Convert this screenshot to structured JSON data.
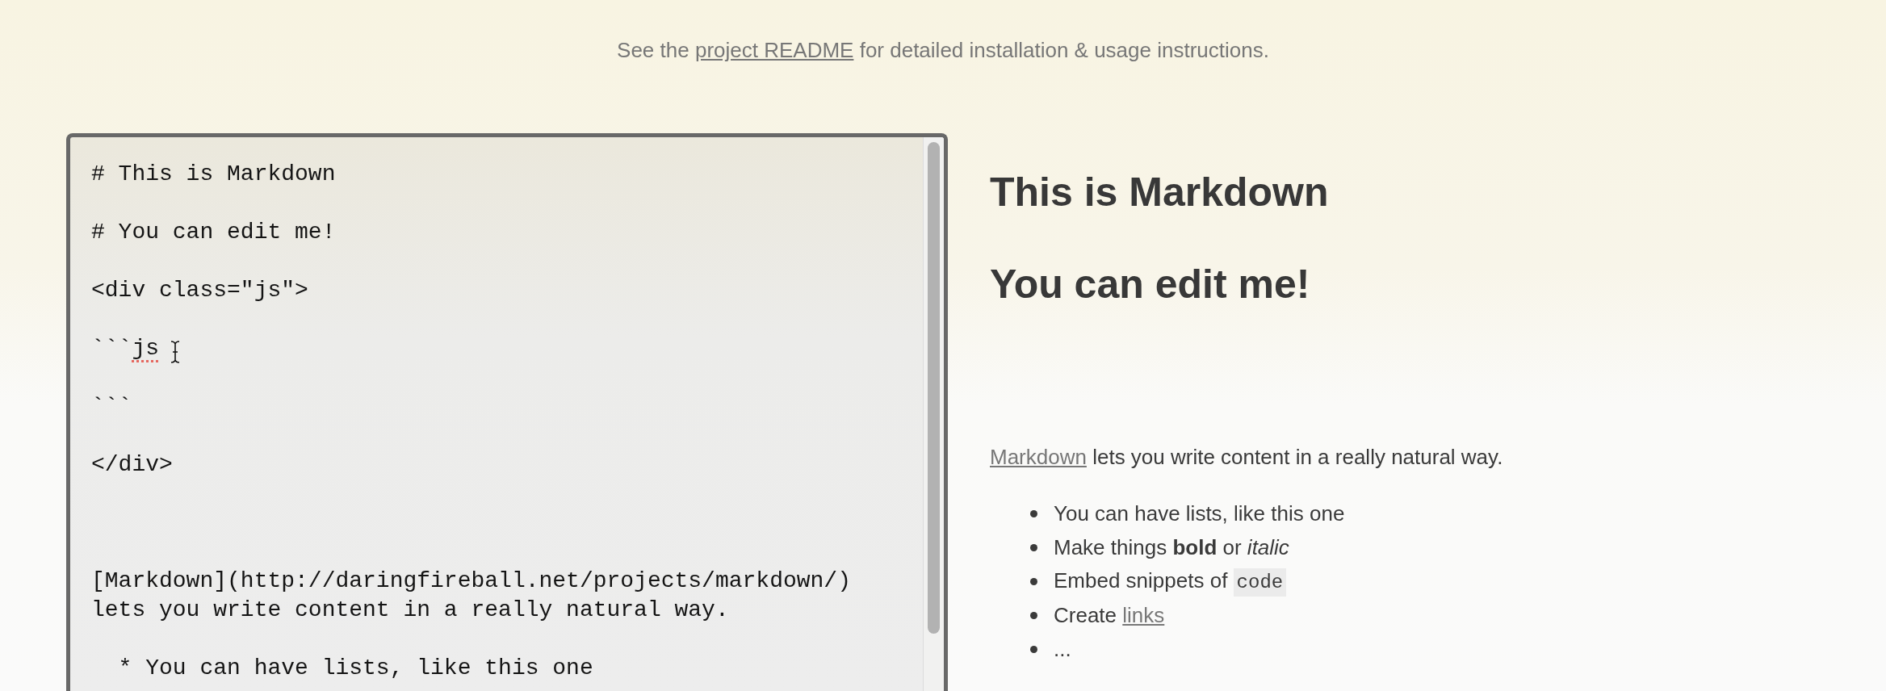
{
  "header": {
    "before": "See the",
    "link": "project README",
    "after": "for detailed installation & usage instructions."
  },
  "editor": {
    "segments": [
      {
        "text": "# This is Markdown\n\n# You can edit me!\n\n<div class=\"js\">\n\n```",
        "misspelled": false
      },
      {
        "text": "js",
        "misspelled": true
      },
      {
        "text": " \n\n```\n\n</div>\n\n\n\n[Markdown](http://daringfireball.net/projects/markdown/)\nlets you write content in a really natural way.\n\n  * You can have lists, like this one",
        "misspelled": false
      }
    ]
  },
  "preview": {
    "headings": [
      "This is Markdown",
      "You can edit me!"
    ],
    "paragraph": {
      "link": "Markdown",
      "text": "lets you write content in a really natural way."
    },
    "list": [
      {
        "text": "You can have lists, like this one"
      },
      {
        "text": "Make things **bold** or *italic*"
      },
      {
        "text": "Embed snippets of",
        "code": "code"
      },
      {
        "text": "Create",
        "link": "links"
      },
      {
        "text": "..."
      }
    ]
  }
}
